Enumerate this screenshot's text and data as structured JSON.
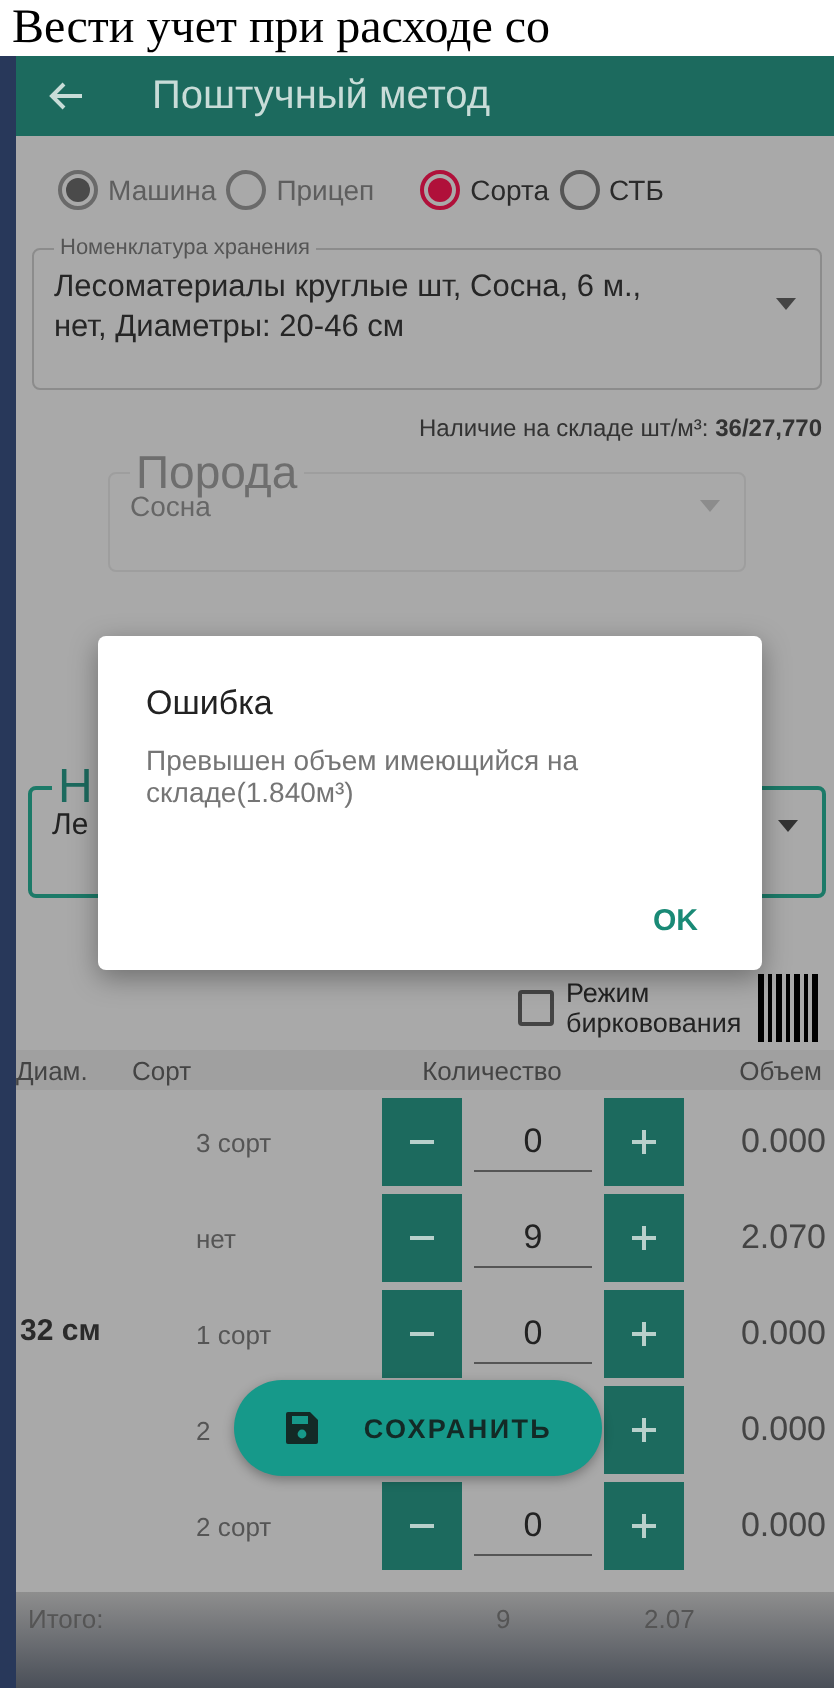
{
  "caption": "Вести учет при расходе со",
  "app_bar": {
    "title": "Поштучный метод"
  },
  "vehicle_options": [
    {
      "label": "Машина",
      "selected": true,
      "disabled": true
    },
    {
      "label": "Прицеп",
      "selected": false,
      "disabled": true
    }
  ],
  "type_options": [
    {
      "label": "Сорта",
      "selected": true,
      "disabled": false
    },
    {
      "label": "СТБ",
      "selected": false,
      "disabled": false
    }
  ],
  "storage_field": {
    "label": "Номенклатура хранения",
    "value": "Лесоматериалы круглые шт, Сосна, 6 м., нет, Диаметры: 20-46 см"
  },
  "stock": {
    "label": "Наличие на складе шт/м³:",
    "value": "36/27,770"
  },
  "species_field": {
    "label": "Порода",
    "value": "Сосна",
    "disabled": true
  },
  "partial_field": {
    "label": "Н",
    "value": "Ле"
  },
  "tagging_mode": {
    "label": "Режим бирковования",
    "checked": false
  },
  "table": {
    "columns": [
      "Диам.",
      "Сорт",
      "Количество",
      "Объем"
    ],
    "diameter": "32 см",
    "rows": [
      {
        "grade": "3 сорт",
        "quantity": "0",
        "volume": "0.000"
      },
      {
        "grade": "нет",
        "quantity": "9",
        "volume": "2.070"
      },
      {
        "grade": "1 сорт",
        "quantity": "0",
        "volume": "0.000"
      },
      {
        "grade": "2",
        "volume": "0.000"
      },
      {
        "grade": "2 сорт",
        "quantity": "0",
        "volume": "0.000"
      }
    ]
  },
  "totals": {
    "label": "Итого:",
    "quantity": "9",
    "volume": "2.07"
  },
  "save_button": {
    "label": "СОХРАНИТЬ"
  },
  "dialog": {
    "title": "Ошибка",
    "message": "Превышен объем имеющийся на складе(1.840м³)",
    "button": "OK"
  }
}
